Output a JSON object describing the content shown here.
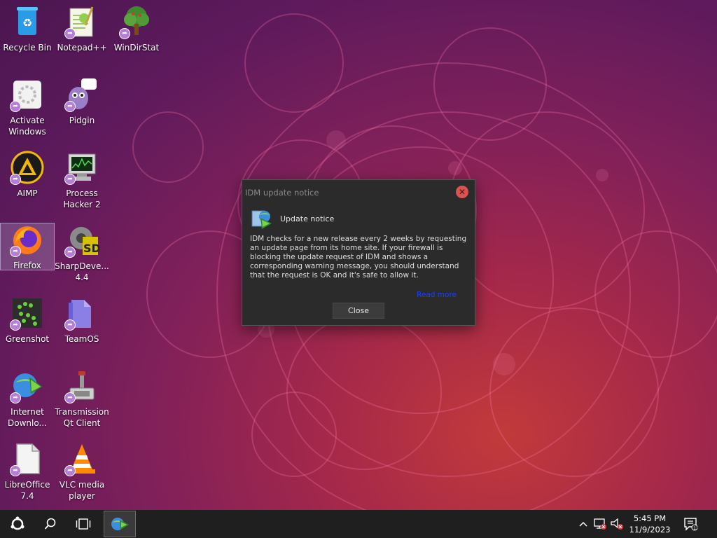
{
  "desktop": {
    "icons": [
      {
        "label": "Recycle Bin",
        "icon": "recycle-bin-icon"
      },
      {
        "label": "Notepad++",
        "icon": "notepadpp-icon"
      },
      {
        "label": "WinDirStat",
        "icon": "windirstat-icon"
      },
      {
        "label": "Activate Windows",
        "icon": "activate-windows-icon"
      },
      {
        "label": "Pidgin",
        "icon": "pidgin-icon"
      },
      {
        "label": "AIMP",
        "icon": "aimp-icon"
      },
      {
        "label": "Process Hacker 2",
        "icon": "process-hacker-icon"
      },
      {
        "label": "Firefox",
        "icon": "firefox-icon"
      },
      {
        "label": "SharpDeve... 4.4",
        "icon": "sharpdevelop-icon"
      },
      {
        "label": "Greenshot",
        "icon": "greenshot-icon"
      },
      {
        "label": "TeamOS",
        "icon": "teamos-icon"
      },
      {
        "label": "Internet Downlo...",
        "icon": "idm-icon"
      },
      {
        "label": "Transmission Qt Client",
        "icon": "transmission-icon"
      },
      {
        "label": "LibreOffice 7.4",
        "icon": "libreoffice-icon"
      },
      {
        "label": "VLC media player",
        "icon": "vlc-icon"
      }
    ]
  },
  "dialog": {
    "title": "IDM update notice",
    "heading": "Update notice",
    "body": "IDM checks for a new release every 2 weeks by requesting an update page from its home site. If your firewall is blocking the update request of IDM and shows a corresponding warning message, you should understand that the request is OK and it's safe to allow it.",
    "link": "Read more",
    "close_label": "Close"
  },
  "taskbar": {
    "time": "5:45 PM",
    "date": "11/9/2023"
  },
  "colors": {
    "accent_link": "#1a3fff",
    "close_red": "#d9534f",
    "taskbar_bg": "#1f1f1f"
  }
}
